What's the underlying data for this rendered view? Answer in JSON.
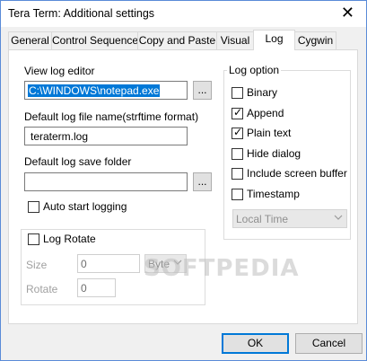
{
  "window": {
    "title": "Tera Term: Additional settings",
    "close_glyph": "✕"
  },
  "tabs": [
    {
      "label": "General"
    },
    {
      "label": "Control Sequence"
    },
    {
      "label": "Copy and Paste"
    },
    {
      "label": "Visual"
    },
    {
      "label": "Log"
    },
    {
      "label": "Cygwin"
    }
  ],
  "active_tab": "Log",
  "log": {
    "view_editor_label": "View log editor",
    "view_editor_value": "C:\\WINDOWS\\notepad.exe",
    "browse_label": "...",
    "default_filename_label": "Default log file name(strftime format)",
    "default_filename_value": "teraterm.log",
    "default_folder_label": "Default log save folder",
    "default_folder_value": "",
    "auto_start_label": "Auto start logging",
    "auto_start_checked": false,
    "rotate": {
      "label": "Log Rotate",
      "checked": false,
      "size_label": "Size",
      "size_value": "0",
      "size_unit": "Byte",
      "rotate_label": "Rotate",
      "rotate_value": "0"
    }
  },
  "log_option": {
    "title": "Log option",
    "items": [
      {
        "label": "Binary",
        "checked": false
      },
      {
        "label": "Append",
        "checked": true
      },
      {
        "label": "Plain text",
        "checked": true
      },
      {
        "label": "Hide dialog",
        "checked": false
      },
      {
        "label": "Include screen buffer",
        "checked": false
      },
      {
        "label": "Timestamp",
        "checked": false
      }
    ],
    "timestamp_mode": "Local Time"
  },
  "watermark": "SOFTPEDIA",
  "buttons": {
    "ok": "OK",
    "cancel": "Cancel"
  },
  "colors": {
    "selection": "#0078d7",
    "default_button_border": "#0078d7"
  }
}
